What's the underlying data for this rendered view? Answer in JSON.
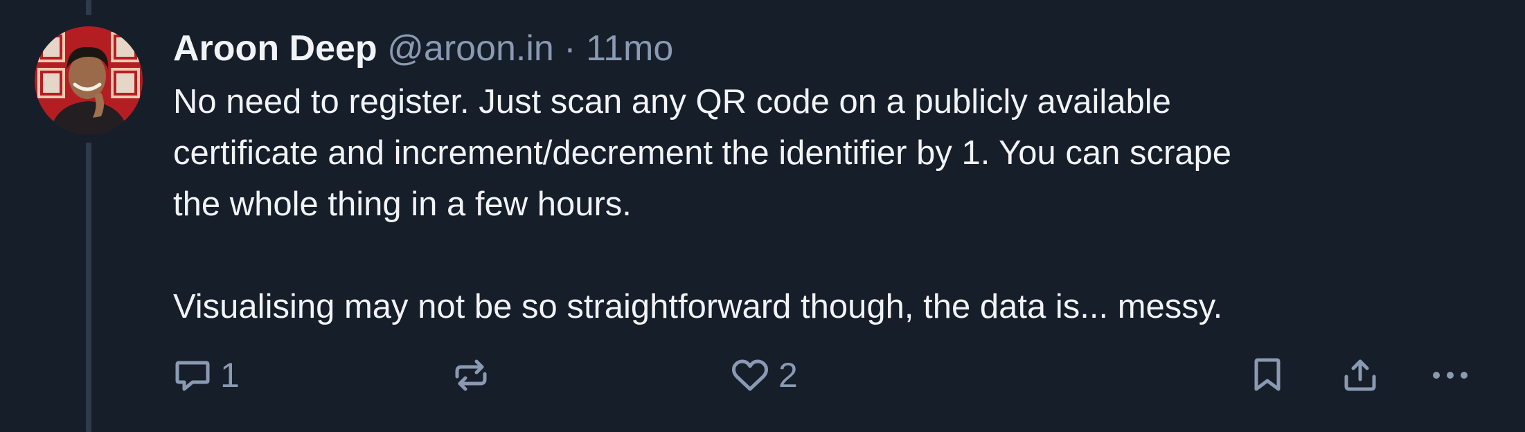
{
  "post": {
    "author_name": "Aroon Deep",
    "author_handle": "@aroon.in",
    "separator": "·",
    "timestamp": "11mo",
    "body": [
      "No need to register. Just scan any QR code on a publicly available",
      "certificate and increment/decrement the identifier by 1. You can scrape",
      "the whole thing in a few hours.",
      "Visualising may not be so straightforward though, the data is... messy."
    ]
  },
  "actions": {
    "reply_icon": "speech-bubble-icon",
    "reply_count": "1",
    "repost_icon": "repost-arrows-icon",
    "like_icon": "heart-icon",
    "like_count": "2",
    "bookmark_icon": "bookmark-icon",
    "share_icon": "share-upload-icon",
    "more_icon": "ellipsis-icon"
  },
  "colors": {
    "background": "#161e2a",
    "text": "#f1f3f6",
    "muted": "#8a9ab2",
    "thread_line": "#2f3a4b"
  }
}
